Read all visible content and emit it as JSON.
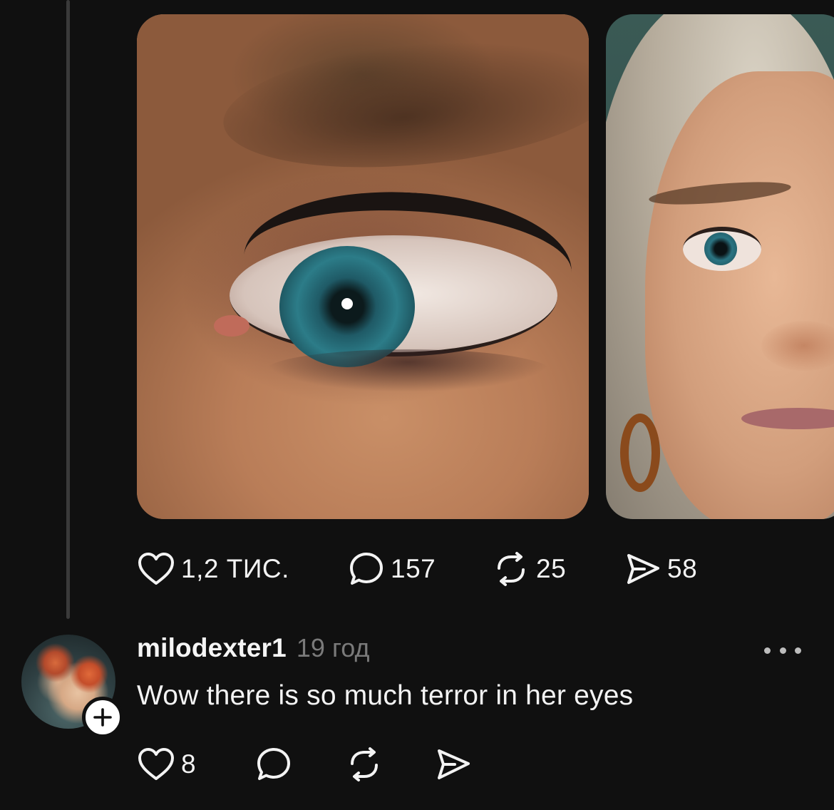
{
  "post": {
    "media": [
      {
        "icon": "eye-closeup-photo"
      },
      {
        "icon": "woman-portrait-photo"
      }
    ],
    "actions": {
      "likes": "1,2 ТИС.",
      "comments": "157",
      "reposts": "25",
      "shares": "58"
    }
  },
  "reply": {
    "username": "milodexter1",
    "timestamp": "19 год",
    "text": "Wow there is so much terror in her eyes",
    "actions": {
      "likes": "8"
    }
  },
  "colors": {
    "background": "#101010",
    "text": "#f3f3f3",
    "muted": "#7a7a7a",
    "thread_line": "#3a3a3a"
  }
}
